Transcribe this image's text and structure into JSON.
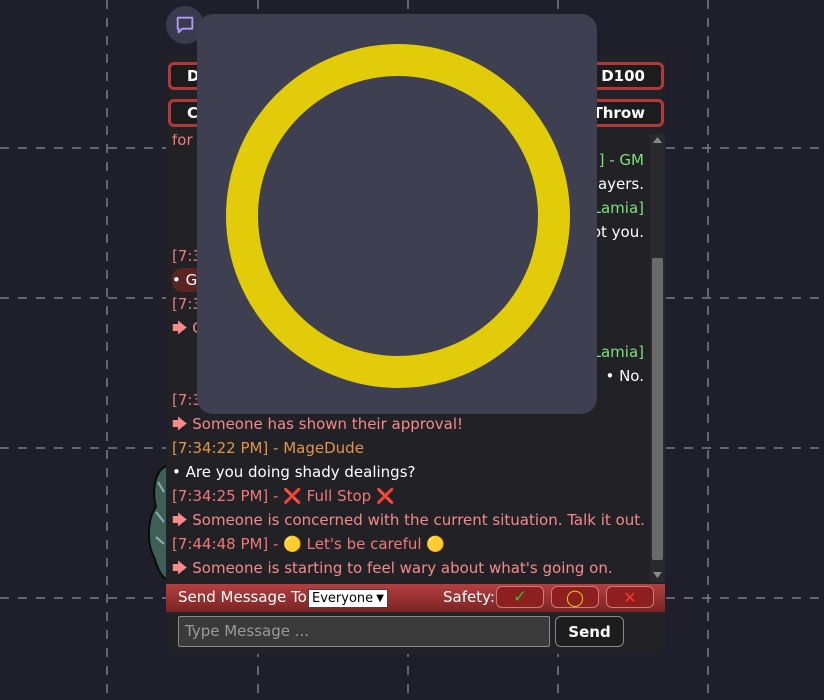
{
  "colors": {
    "background": "#1e1f2b",
    "accent_red": "#b03a3a",
    "safety_yellow": "#e2cc0a"
  },
  "icons": {
    "chat_toggle": "chat-bubble-icon",
    "safety_ok": "checkmark-icon",
    "safety_careful": "circle-icon",
    "safety_stop": "x-icon",
    "popup_symbol": "yellow-ring-icon",
    "scroll_up": "triangle-up-icon",
    "scroll_down": "triangle-down-icon"
  },
  "dice": {
    "row1_left": "D",
    "row1_right": "D100",
    "row2_left": "C",
    "row2_right": "Throw"
  },
  "log": {
    "lines": [
      {
        "text": "for a",
        "cls": "ts-red"
      },
      {
        "text": "] - GM",
        "cls": "ts-green",
        "right": true
      },
      {
        "text": "players.",
        "cls": "white",
        "right": true
      },
      {
        "text": "Lamia]",
        "cls": "ts-green",
        "right": true
      },
      {
        "text": "ot you.",
        "cls": "white",
        "right": true
      },
      {
        "text": "[7:3",
        "cls": "ts-red"
      },
      {
        "text": "• Gi",
        "cls": "white",
        "pill": true
      },
      {
        "text": "[7:3",
        "cls": "ts-red"
      },
      {
        "text": "🡆 G",
        "cls": "pink"
      },
      {
        "text": "Lamia]",
        "cls": "ts-green",
        "right": true
      },
      {
        "text": "• No.",
        "cls": "white",
        "right": true
      },
      {
        "text": "[7:3",
        "cls": "ts-red"
      },
      {
        "text": "🡆 Someone has shown their approval!",
        "cls": "pink"
      },
      {
        "text": "[7:34:22 PM] - MageDude",
        "cls": "ts-orange"
      },
      {
        "text": "• Are you doing shady dealings?",
        "cls": "white"
      },
      {
        "text": "[7:34:25 PM] -  ❌  Full Stop  ❌",
        "cls": "ts-red"
      },
      {
        "text": "🡆 Someone is concerned with the current situation. Talk it out.",
        "cls": "pink"
      },
      {
        "text": "[7:44:48 PM] -  🟡  Let's be careful  🟡",
        "cls": "ts-red"
      },
      {
        "text": "🡆 Someone is starting to feel wary about what's going on.",
        "cls": "pink"
      }
    ]
  },
  "send_bar": {
    "send_to_label": "Send Message To:",
    "recipient": "Everyone",
    "safety_label": "Safety:",
    "safety_ok": "✓",
    "safety_careful": "◯",
    "safety_stop": "✕"
  },
  "message": {
    "placeholder": "Type Message ...",
    "send_label": "Send"
  }
}
